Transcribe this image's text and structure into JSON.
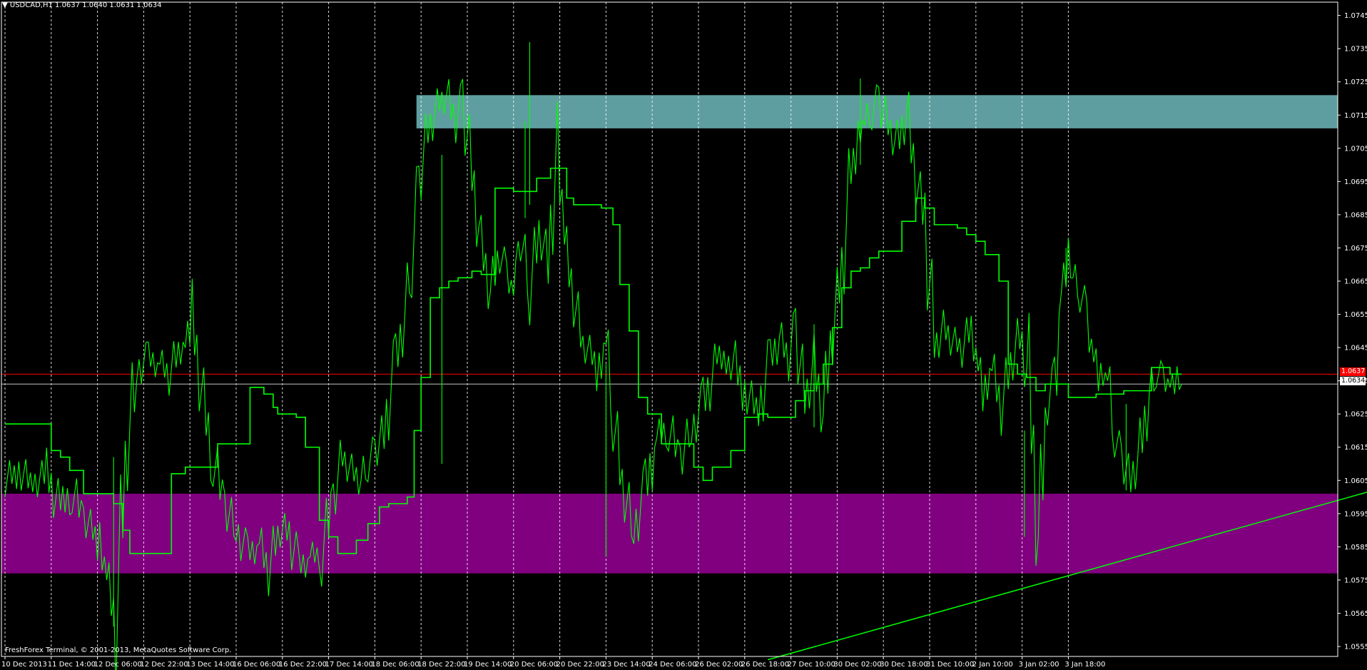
{
  "header": {
    "collapse_glyph": "▼",
    "symbol": "USDCAD,H1",
    "ohlc": "1.0637 1.0640 1.0631 1.0634"
  },
  "footer": {
    "credits": "FreshForex Terminal, © 2001-2013, MetaQuotes Software Corp."
  },
  "price_tags": {
    "ask": "1.0637",
    "bid": "1.0634"
  },
  "colors": {
    "background": "#000000",
    "price_line": "#00ff00",
    "moving_average": "#00ff00",
    "grid": "#ffffff",
    "resistance_zone": "#5f9ea0",
    "support_zone": "#800080",
    "ask_line": "#ff0000",
    "bid_line": "#c0c0c0",
    "trendline": "#00ff00"
  },
  "chart_data": {
    "type": "line",
    "title": "USDCAD,H1",
    "x_axis_labels": [
      "10 Dec 2013",
      "11 Dec 14:00",
      "12 Dec 06:00",
      "12 Dec 22:00",
      "13 Dec 14:00",
      "16 Dec 06:00",
      "16 Dec 22:00",
      "17 Dec 14:00",
      "18 Dec 06:00",
      "18 Dec 22:00",
      "19 Dec 14:00",
      "20 Dec 06:00",
      "20 Dec 22:00",
      "23 Dec 14:00",
      "24 Dec 06:00",
      "26 Dec 02:00",
      "26 Dec 18:00",
      "27 Dec 10:00",
      "30 Dec 02:00",
      "30 Dec 18:00",
      "31 Dec 10:00",
      "2 Jan 10:00",
      "3 Jan 02:00",
      "3 Jan 18:00"
    ],
    "y_axis_labels": [
      "1.0745",
      "1.0735",
      "1.0725",
      "1.0715",
      "1.0705",
      "1.0695",
      "1.0685",
      "1.0675",
      "1.0665",
      "1.0655",
      "1.0645",
      "1.0635",
      "1.0625",
      "1.0615",
      "1.0605",
      "1.0595",
      "1.0585",
      "1.0575",
      "1.0565",
      "1.0555"
    ],
    "ylim": [
      1.0552,
      1.0749
    ],
    "grid": "vertical dashed",
    "series": [
      {
        "style": "price",
        "x_index": [
          0,
          0.3,
          0.6,
          0.9,
          1.2,
          1.45,
          1.7,
          1.9,
          2.05,
          2.2,
          2.4,
          2.6,
          2.85,
          3.1,
          3.35,
          3.55,
          3.75,
          3.9,
          4.05,
          4.25,
          4.5,
          4.75,
          5.0,
          5.25,
          5.5,
          5.7,
          5.9,
          6.1,
          6.35,
          6.6,
          6.85,
          7.1,
          7.3,
          7.5,
          7.7,
          7.85,
          8.0,
          8.2,
          8.45,
          8.65,
          8.8,
          8.95,
          9.15,
          9.35,
          9.55,
          9.75,
          9.9,
          10.1,
          10.3,
          10.5,
          10.7,
          10.85,
          11.0,
          11.1,
          11.2,
          11.35,
          11.55,
          11.75,
          11.95,
          12.1,
          12.3,
          12.5,
          12.7,
          12.85,
          13.0,
          13.15,
          13.35,
          13.6,
          13.85,
          14.1,
          14.35,
          14.6,
          14.85,
          15.1,
          15.4,
          15.7,
          16.0,
          16.3,
          16.55,
          16.75,
          16.95,
          17.1,
          17.3,
          17.5,
          17.7,
          17.9,
          18.1,
          18.3,
          18.45,
          18.6,
          18.75,
          18.9,
          19.1,
          19.3,
          19.5,
          19.7,
          19.9,
          20.1,
          20.3,
          20.5,
          20.7,
          20.9,
          21.05,
          21.2,
          21.35,
          21.55,
          21.75,
          21.95,
          22.15,
          22.35,
          22.55,
          22.7,
          22.85,
          23.0,
          23.1,
          23.25
        ],
        "values": [
          1.0605,
          1.0608,
          1.0604,
          1.0607,
          1.0596,
          1.0602,
          1.0594,
          1.059,
          1.0585,
          1.0575,
          1.0562,
          1.061,
          1.0638,
          1.0642,
          1.064,
          1.0637,
          1.0644,
          1.0648,
          1.0654,
          1.0632,
          1.0612,
          1.0598,
          1.059,
          1.0583,
          1.0586,
          1.0578,
          1.0589,
          1.0591,
          1.0579,
          1.0582,
          1.0583,
          1.06,
          1.0612,
          1.0608,
          1.0605,
          1.061,
          1.0614,
          1.062,
          1.064,
          1.0655,
          1.0672,
          1.0695,
          1.071,
          1.0718,
          1.0721,
          1.0713,
          1.072,
          1.0698,
          1.0676,
          1.0662,
          1.0673,
          1.0668,
          1.0664,
          1.0672,
          1.0675,
          1.0662,
          1.068,
          1.0672,
          1.0705,
          1.0676,
          1.066,
          1.0646,
          1.0643,
          1.0636,
          1.0646,
          1.0625,
          1.0604,
          1.059,
          1.0602,
          1.0618,
          1.0621,
          1.0612,
          1.062,
          1.0628,
          1.064,
          1.0643,
          1.0632,
          1.0626,
          1.0641,
          1.0648,
          1.0642,
          1.0651,
          1.0629,
          1.064,
          1.0625,
          1.065,
          1.0668,
          1.0698,
          1.0708,
          1.0712,
          1.0716,
          1.072,
          1.0712,
          1.0706,
          1.0716,
          1.0696,
          1.0683,
          1.0645,
          1.0651,
          1.0647,
          1.0645,
          1.0651,
          1.0642,
          1.063,
          1.0638,
          1.0627,
          1.064,
          1.0649,
          1.0635,
          1.0588,
          1.0628,
          1.0635,
          1.0665,
          1.0672,
          1.0666,
          1.0662
        ],
        "x_index_tail": [
          23.4,
          23.55,
          23.7,
          23.85,
          24.0,
          24.15,
          24.35,
          24.55,
          24.75,
          24.9,
          25.05,
          25.2,
          25.35,
          25.45
        ],
        "values_tail": [
          1.0655,
          1.0644,
          1.0636,
          1.0635,
          1.0618,
          1.0612,
          1.0605,
          1.0614,
          1.0631,
          1.0637,
          1.0637,
          1.0635,
          1.0635,
          1.0634
        ]
      },
      {
        "style": "moving-average",
        "x_index": [
          0,
          0.8,
          1.0,
          1.2,
          1.4,
          1.7,
          2.0,
          2.2,
          2.35,
          2.55,
          2.7,
          3.6,
          3.9,
          4.1,
          4.2,
          4.3,
          4.6,
          5.0,
          5.3,
          5.6,
          5.8,
          5.9,
          6.1,
          6.3,
          6.5,
          6.8,
          7.0,
          7.2,
          7.35,
          7.6,
          7.85,
          8.1,
          8.3,
          8.5,
          8.7,
          8.85,
          9.0,
          9.2,
          9.4,
          9.6,
          9.8,
          10.1,
          10.3,
          10.6,
          10.8,
          11.0,
          11.2,
          11.5,
          11.8,
          12.0,
          12.15,
          12.3,
          12.6,
          12.9,
          13.15,
          13.3,
          13.5,
          13.7,
          13.9,
          14.2,
          14.6,
          14.8,
          14.9,
          15.1,
          15.3,
          15.7,
          16.0,
          16.3,
          16.5,
          16.7,
          16.9,
          17.1,
          17.3,
          17.5,
          17.7,
          17.9,
          18.1,
          18.3,
          18.5,
          18.7,
          18.9,
          19.1,
          19.4,
          19.7,
          19.9,
          20.1,
          20.3,
          20.6,
          20.8,
          21.0,
          21.2,
          21.5,
          21.7,
          21.9,
          22.1,
          22.3,
          22.5,
          22.7,
          23.0,
          23.3,
          23.6,
          23.8,
          24.0,
          24.2,
          24.4,
          24.6,
          24.8,
          25.0,
          25.2,
          25.45
        ],
        "values": [
          1.0622,
          1.0622,
          1.0614,
          1.0612,
          1.0608,
          1.0601,
          1.0601,
          1.0601,
          1.0598,
          1.059,
          1.0583,
          1.0607,
          1.0609,
          1.0609,
          1.0609,
          1.0609,
          1.0616,
          1.0616,
          1.0633,
          1.0631,
          1.0627,
          1.0625,
          1.0625,
          1.0624,
          1.0615,
          1.0593,
          1.0588,
          1.0583,
          1.0583,
          1.0587,
          1.0592,
          1.0597,
          1.0598,
          1.0598,
          1.06,
          1.062,
          1.0636,
          1.066,
          1.0663,
          1.0665,
          1.0666,
          1.0668,
          1.0667,
          1.0693,
          1.0693,
          1.0692,
          1.0692,
          1.0696,
          1.0699,
          1.0699,
          1.069,
          1.0688,
          1.0688,
          1.0687,
          1.0682,
          1.0664,
          1.065,
          1.063,
          1.0625,
          1.0616,
          1.0616,
          1.0616,
          1.0609,
          1.0605,
          1.0609,
          1.0614,
          1.0624,
          1.0625,
          1.0624,
          1.0624,
          1.0624,
          1.0629,
          1.0632,
          1.0634,
          1.064,
          1.0651,
          1.0663,
          1.0668,
          1.0669,
          1.0672,
          1.0674,
          1.0674,
          1.0683,
          1.069,
          1.0687,
          1.0682,
          1.0682,
          1.0681,
          1.0679,
          1.0677,
          1.0673,
          1.0665,
          1.064,
          1.0637,
          1.0636,
          1.0632,
          1.0634,
          1.0634,
          1.063,
          1.063,
          1.0631,
          1.0631,
          1.0631,
          1.0632,
          1.0632,
          1.0632,
          1.0639,
          1.0639,
          1.0637,
          1.0637
        ]
      }
    ],
    "zones": [
      {
        "name": "resistance-zone",
        "from_index": 8.9,
        "to_index": 29.6,
        "y_low": 1.0711,
        "y_high": 1.0721
      },
      {
        "name": "support-zone",
        "from_index": -0.2,
        "to_index": 29.3,
        "y_low": 1.0577,
        "y_high": 1.0601
      }
    ],
    "horizontal_lines": [
      {
        "name": "ask-line",
        "value": 1.0637
      },
      {
        "name": "bid-line",
        "value": 1.0634
      }
    ],
    "trendline": {
      "from_index": 16.5,
      "from_value": 1.0551,
      "to_index": 29.6,
      "to_value": 1.0602
    }
  }
}
